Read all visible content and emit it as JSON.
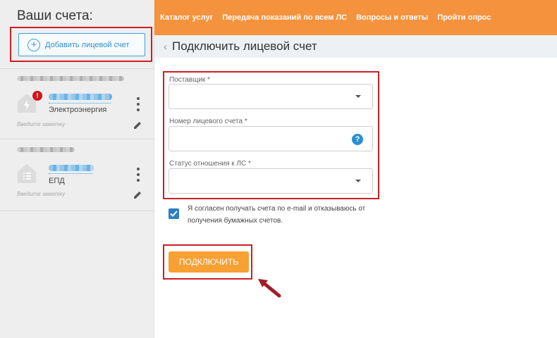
{
  "sidebar": {
    "title": "Ваши счета:",
    "add_account_label": "Добавить лицевой счет",
    "accounts": [
      {
        "service": "Электроэнергия",
        "note_placeholder": "Введите заметку",
        "alert": "!"
      },
      {
        "service": "ЕПД",
        "note_placeholder": "Введите заметку"
      }
    ]
  },
  "nav": {
    "links": [
      "Каталог услуг",
      "Передача показаний по всем ЛС",
      "Вопросы и ответы",
      "Пройти опрос"
    ]
  },
  "page": {
    "back": "‹",
    "title": "Подключить лицевой счет"
  },
  "form": {
    "provider_label": "Поставщик *",
    "account_number_label": "Номер лицевого счета *",
    "help": "?",
    "relation_status_label": "Статус отношения к ЛС *",
    "consent_text": "Я согласен получать счета по e-mail и отказываюсь от получения бумажных счетов.",
    "consent_checked": true,
    "submit_label": "ПОДКЛЮЧИТЬ"
  },
  "colors": {
    "accent_orange": "#f5923e",
    "button_orange": "#f7a033",
    "highlight_red": "#cc1f24",
    "link_blue": "#2e8fc9"
  }
}
